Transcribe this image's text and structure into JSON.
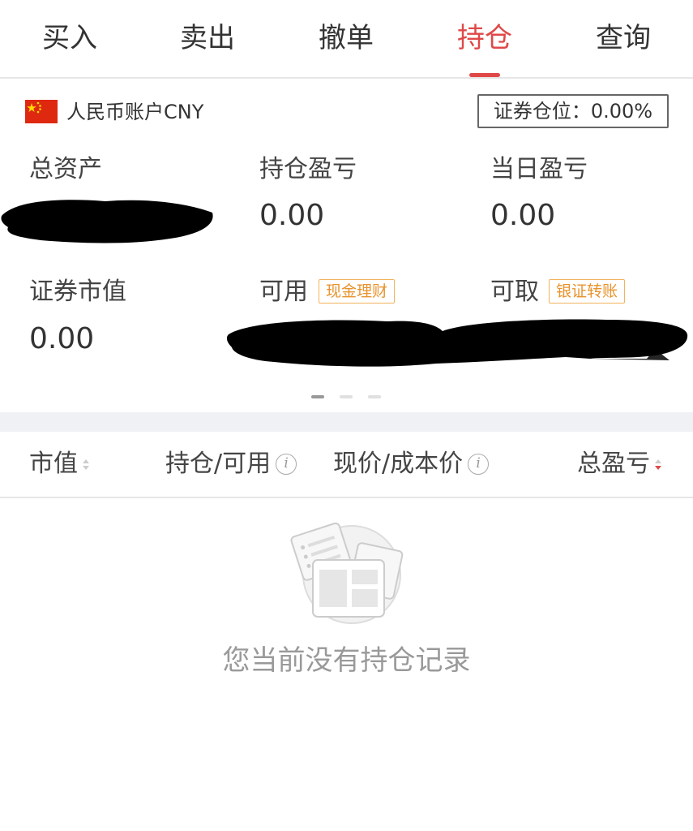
{
  "tabs": [
    {
      "label": "买入",
      "active": false
    },
    {
      "label": "卖出",
      "active": false
    },
    {
      "label": "撤单",
      "active": false
    },
    {
      "label": "持仓",
      "active": true
    },
    {
      "label": "查询",
      "active": false
    }
  ],
  "account": {
    "currency_label": "人民币账户CNY",
    "position_badge": "证券仓位：0.00%"
  },
  "stats": {
    "total_assets": {
      "label": "总资产",
      "value": ""
    },
    "position_pnl": {
      "label": "持仓盈亏",
      "value": "0.00"
    },
    "daily_pnl": {
      "label": "当日盈亏",
      "value": "0.00"
    },
    "market_value": {
      "label": "证券市值",
      "value": "0.00"
    },
    "available": {
      "label": "可用",
      "tag": "现金理财",
      "value": ""
    },
    "withdrawable": {
      "label": "可取",
      "tag": "银证转账",
      "value": ""
    }
  },
  "table_header": {
    "col1": "市值",
    "col2": "持仓/可用",
    "col3": "现价/成本价",
    "col4": "总盈亏"
  },
  "empty_state": {
    "message": "您当前没有持仓记录",
    "icon": "empty-list-icon"
  },
  "colors": {
    "accent": "#e04848",
    "tag": "#e8932d",
    "redacted": "#000000"
  }
}
